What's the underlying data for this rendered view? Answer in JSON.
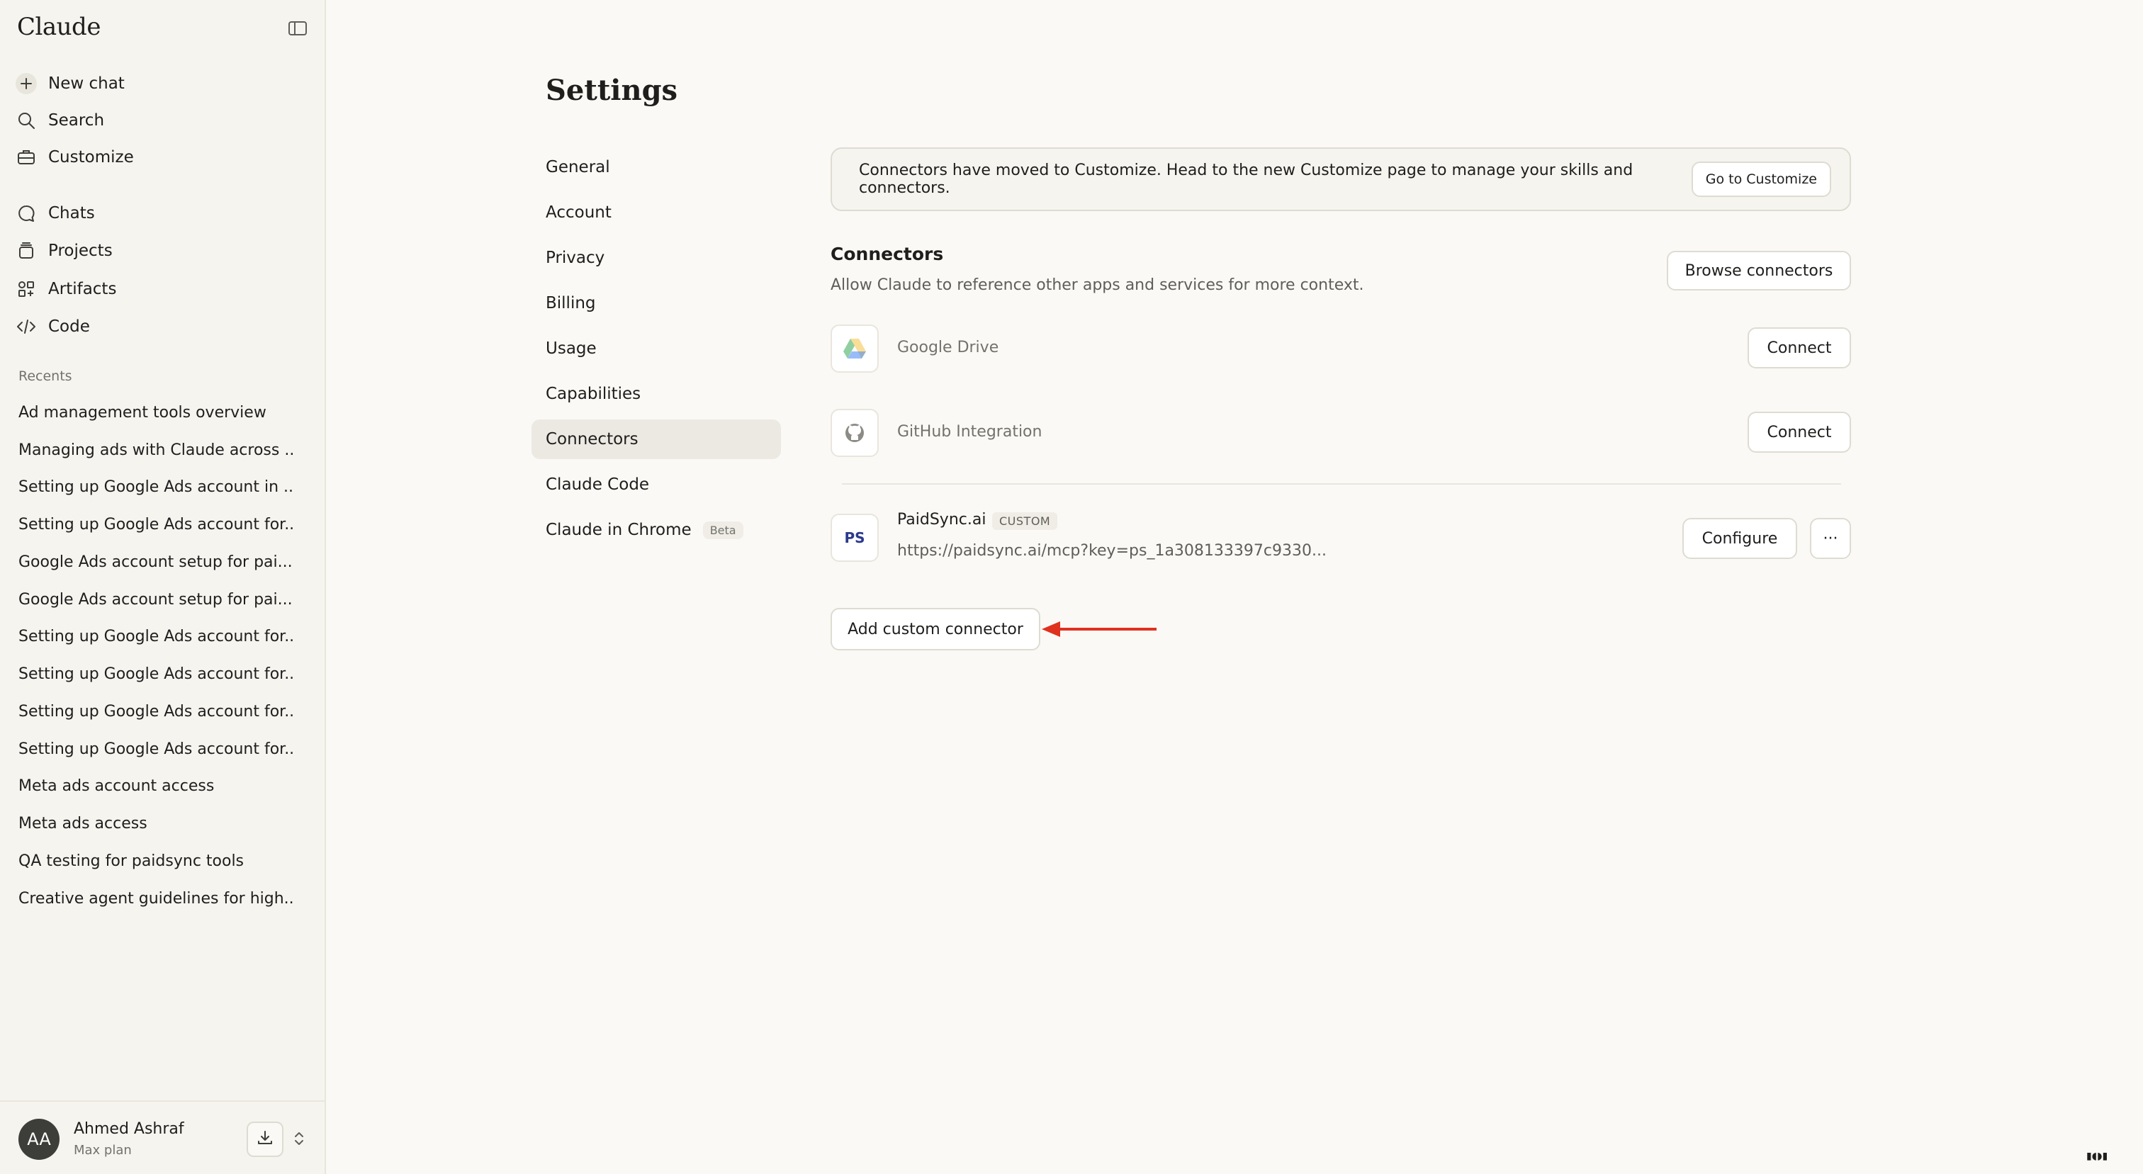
{
  "app": {
    "brand": "Claude"
  },
  "sidebar": {
    "nav": [
      {
        "label": "New chat",
        "icon": "plus-icon"
      },
      {
        "label": "Search",
        "icon": "search-icon"
      },
      {
        "label": "Customize",
        "icon": "briefcase-icon"
      },
      {
        "label": "Chats",
        "icon": "chat-bubble-icon"
      },
      {
        "label": "Projects",
        "icon": "folder-stack-icon"
      },
      {
        "label": "Artifacts",
        "icon": "artifacts-icon"
      },
      {
        "label": "Code",
        "icon": "code-icon"
      }
    ],
    "recents_label": "Recents",
    "recents": [
      "Ad management tools overview",
      "Managing ads with Claude across ...",
      "Setting up Google Ads account in ...",
      "Setting up Google Ads account for...",
      "Google Ads account setup for pai...",
      "Google Ads account setup for pai...",
      "Setting up Google Ads account for...",
      "Setting up Google Ads account for...",
      "Setting up Google Ads account for...",
      "Setting up Google Ads account for...",
      "Meta ads account access",
      "Meta ads access",
      "QA testing for paidsync tools",
      "Creative agent guidelines for high..."
    ],
    "user": {
      "initials": "AA",
      "name": "Ahmed Ashraf",
      "plan": "Max plan"
    }
  },
  "settings": {
    "title": "Settings",
    "nav": [
      {
        "label": "General"
      },
      {
        "label": "Account"
      },
      {
        "label": "Privacy"
      },
      {
        "label": "Billing"
      },
      {
        "label": "Usage"
      },
      {
        "label": "Capabilities"
      },
      {
        "label": "Connectors",
        "active": true
      },
      {
        "label": "Claude Code"
      },
      {
        "label": "Claude in Chrome",
        "badge": "Beta"
      }
    ]
  },
  "notice": {
    "text": "Connectors have moved to Customize. Head to the new Customize page to manage your skills and connectors.",
    "button": "Go to Customize"
  },
  "connectors": {
    "title": "Connectors",
    "subtitle": "Allow Claude to reference other apps and services for more context.",
    "browse_button": "Browse connectors",
    "items": [
      {
        "name": "Google Drive",
        "icon": "google-drive-icon",
        "action": "Connect"
      },
      {
        "name": "GitHub Integration",
        "icon": "github-icon",
        "action": "Connect"
      }
    ],
    "custom": {
      "logo_text": "PS",
      "name": "PaidSync.ai",
      "badge": "CUSTOM",
      "url": "https://paidsync.ai/mcp?key=ps_1a308133397c9330...",
      "configure_button": "Configure",
      "more_button": "···"
    },
    "add_button": "Add custom connector"
  },
  "colors": {
    "background": "#faf9f5",
    "sidebar": "#f5f4ef",
    "annotation_arrow": "#e0311f"
  }
}
